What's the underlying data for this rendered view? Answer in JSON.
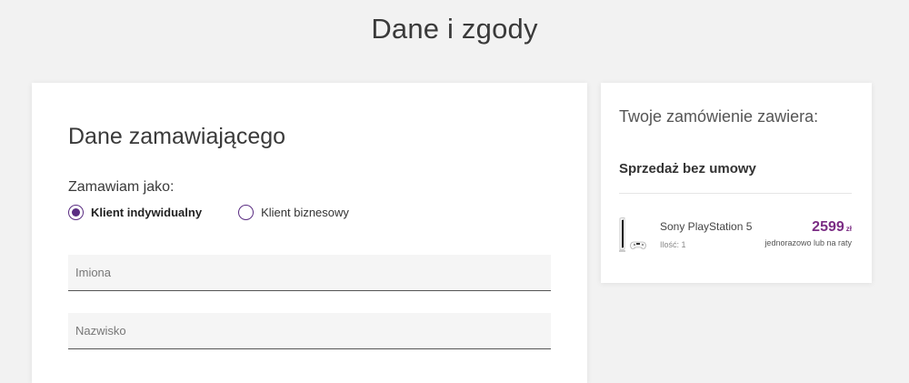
{
  "page": {
    "title": "Dane i zgody"
  },
  "form": {
    "section_title": "Dane zamawiającego",
    "zamawiam_label": "Zamawiam jako:",
    "radio_options": [
      {
        "label": "Klient indywidualny",
        "selected": true
      },
      {
        "label": "Klient biznesowy",
        "selected": false
      }
    ],
    "fields": {
      "first_name": {
        "placeholder": "Imiona",
        "value": ""
      },
      "last_name": {
        "placeholder": "Nazwisko",
        "value": ""
      }
    }
  },
  "summary": {
    "title": "Twoje zamówienie zawiera:",
    "subtitle": "Sprzedaż bez umowy",
    "product": {
      "name": "Sony PlayStation 5",
      "quantity_label": "Ilość: 1",
      "price": "2599",
      "currency": "zł",
      "price_note": "jednorazowo lub na raty",
      "image_icon": "playstation-console-icon"
    }
  },
  "colors": {
    "accent": "#7b2d84",
    "radio": "#5a2d82",
    "background": "#f2f2f2"
  }
}
